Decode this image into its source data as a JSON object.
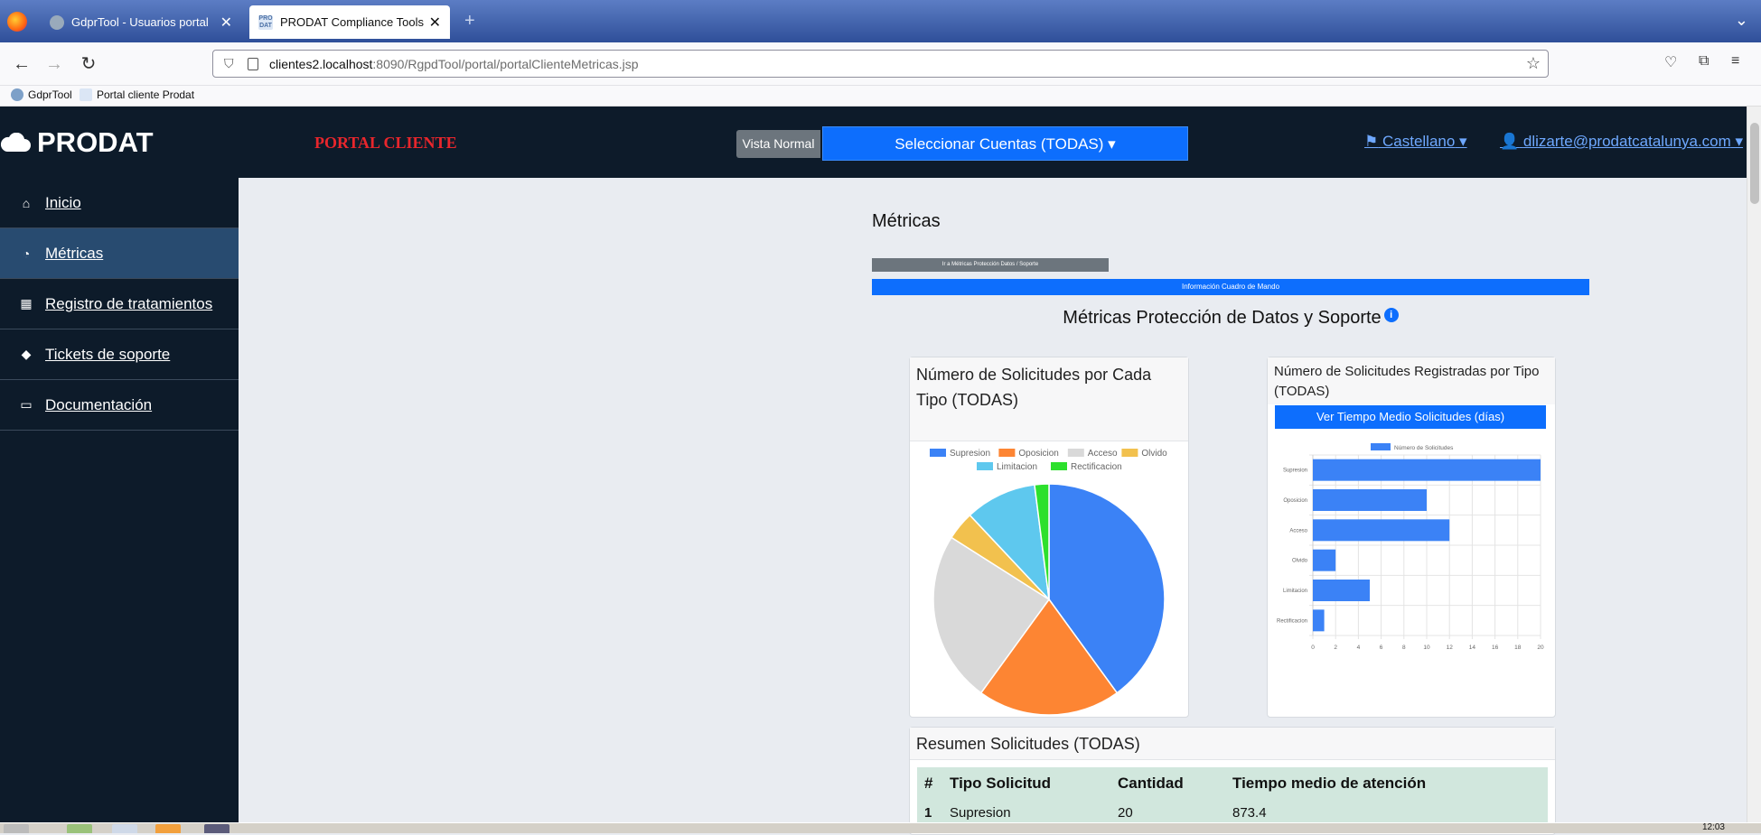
{
  "browser": {
    "tabs": [
      {
        "label": "GdprTool - Usuarios portal"
      },
      {
        "label": "PRODAT Compliance Tools"
      }
    ],
    "url": {
      "host": "clientes2.localhost",
      "rest": ":8090/RgpdTool/portal/portalClienteMetricas.jsp"
    },
    "bookmarks": [
      "GdprTool",
      "Portal cliente Prodat"
    ]
  },
  "header": {
    "brand": "PRODAT",
    "portal_label": "PORTAL CLIENTE",
    "vista_button": "Vista Normal",
    "cuentas_button": "Seleccionar Cuentas (TODAS)",
    "language": "Castellano",
    "user_email": "dlizarte@prodatcatalunya.com"
  },
  "sidebar": {
    "items": [
      {
        "label": "Inicio",
        "icon": "home-icon"
      },
      {
        "label": "Métricas",
        "icon": "dashboard-icon",
        "active": true
      },
      {
        "label": "Registro de tratamientos",
        "icon": "grid-icon"
      },
      {
        "label": "Tickets de soporte",
        "icon": "tag-icon"
      },
      {
        "label": "Documentación",
        "icon": "folder-open-icon"
      }
    ]
  },
  "main": {
    "title": "Métricas",
    "goto_button": "Ir a Métricas Protección Datos / Soporte",
    "info_bar": "Información Cuadro de Mando",
    "section_title": "Métricas Protección de Datos y Soporte",
    "pie_card_title": "Número de Solicitudes por Cada Tipo (TODAS)",
    "bar_card_title": "Número de Solicitudes Registradas por Tipo (TODAS)",
    "tiempo_button": "Ver Tiempo Medio Solicitudes (días)",
    "resumen_title": "Resumen Solicitudes (TODAS)",
    "table": {
      "headers": [
        "#",
        "Tipo Solicitud",
        "Cantidad",
        "Tiempo medio de atención"
      ],
      "rows": [
        [
          "1",
          "Supresion",
          "20",
          "873.4"
        ]
      ]
    }
  },
  "colors": {
    "supresion": "#3b82f6",
    "oposicion": "#fd8533",
    "acceso": "#d9d9d9",
    "olvido": "#f2c14e",
    "limitacion": "#5ec8ee",
    "rectificacion": "#2de02d"
  },
  "chart_data": [
    {
      "type": "pie",
      "categories": [
        "Supresion",
        "Oposicion",
        "Acceso",
        "Olvido",
        "Limitacion",
        "Rectificacion"
      ],
      "values": [
        20,
        10,
        12,
        2,
        5,
        1
      ]
    },
    {
      "type": "bar",
      "orientation": "horizontal",
      "categories": [
        "Supresion",
        "Oposicion",
        "Acceso",
        "Olvido",
        "Limitacion",
        "Rectificacion"
      ],
      "series": [
        {
          "name": "Número de Solicitudes",
          "values": [
            20,
            10,
            12,
            2,
            5,
            1
          ]
        }
      ],
      "xlim": [
        0,
        20
      ],
      "xticks": [
        0,
        2,
        4,
        6,
        8,
        10,
        12,
        14,
        16,
        18,
        20
      ],
      "grid": true,
      "legend": "top"
    }
  ],
  "taskbar": {
    "clock": "12:03"
  }
}
